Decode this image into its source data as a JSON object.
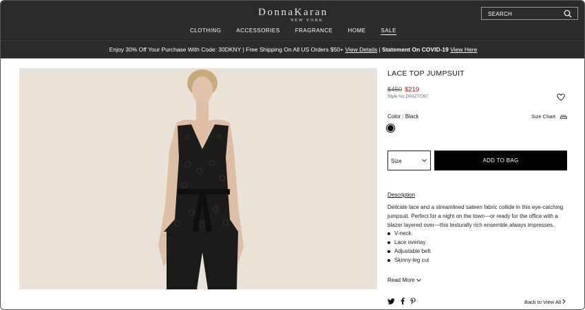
{
  "brand": {
    "name": "DonnaKaran",
    "tagline": "NEW YORK"
  },
  "search": {
    "label": "SEARCH"
  },
  "nav": [
    "CLOTHING",
    "ACCESSORIES",
    "FRAGRANCE",
    "HOME",
    "SALE"
  ],
  "promo": {
    "text": "Enjoy 30% Off Your Purchase With Code: 30DKNY | Free Shipping On All US Orders $50+ ",
    "link1": "View Details",
    "sep": " | ",
    "bold": "Statement On COVID-19",
    "link2": "View Here"
  },
  "product": {
    "title": "LACE TOP JUMPSUIT",
    "price_old": "$450",
    "price_new": "$219",
    "style_no": "Style No D0AZTC67",
    "color_label": "Color : Black",
    "size_chart": "Size Chart",
    "size_placeholder": "Size",
    "add_to_bag": "ADD TO BAG",
    "description_heading": "Description",
    "description": "Delicate lace and a streamlined sateen fabric collide in this eye-catching jumpsuit. Perfect for a night on the town—or ready for the office with a blazer layered over—this texturally rich ensemble always impresses.",
    "features": [
      "V-neck",
      "Lace overlay",
      "Adjustable belt",
      "Skinny-leg cut"
    ],
    "read_more": "Read More",
    "back_link": "Back to View All"
  },
  "colors": {
    "accent_sale": "#b01010",
    "header_bg": "#2b2b2b",
    "swatch": "#000000"
  }
}
